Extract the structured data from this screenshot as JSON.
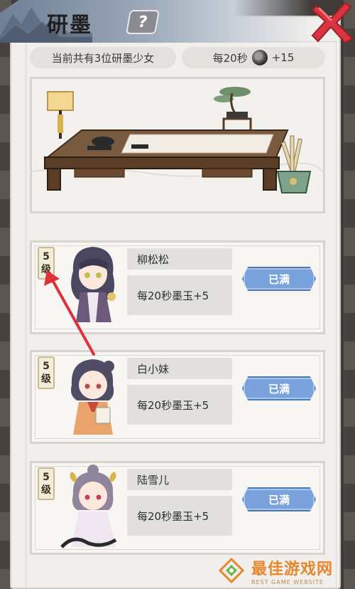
{
  "window": {
    "title": "研墨",
    "help_icon": "question-mark-icon",
    "close_icon": "close-x-icon"
  },
  "summary": {
    "count_text": "当前共有3位研墨少女",
    "rate_prefix": "每20秒",
    "rate_icon": "ink-jade-icon",
    "rate_value": "+15"
  },
  "girls": [
    {
      "level_num": "5",
      "level_unit": "级",
      "name": "柳松松",
      "rate": "每20秒墨玉+5",
      "button": "已满"
    },
    {
      "level_num": "5",
      "level_unit": "级",
      "name": "白小妹",
      "rate": "每20秒墨玉+5",
      "button": "已满"
    },
    {
      "level_num": "5",
      "level_unit": "级",
      "name": "陆雪儿",
      "rate": "每20秒墨玉+5",
      "button": "已满"
    }
  ],
  "watermark": {
    "main": "最佳游戏网",
    "sub": "BEST GAME WEBSITE"
  },
  "colors": {
    "accent_button": "#7aa2dc",
    "annotation_arrow": "#e0303a",
    "close_x": "#d9343f",
    "watermark_orange": "#e8862b"
  }
}
